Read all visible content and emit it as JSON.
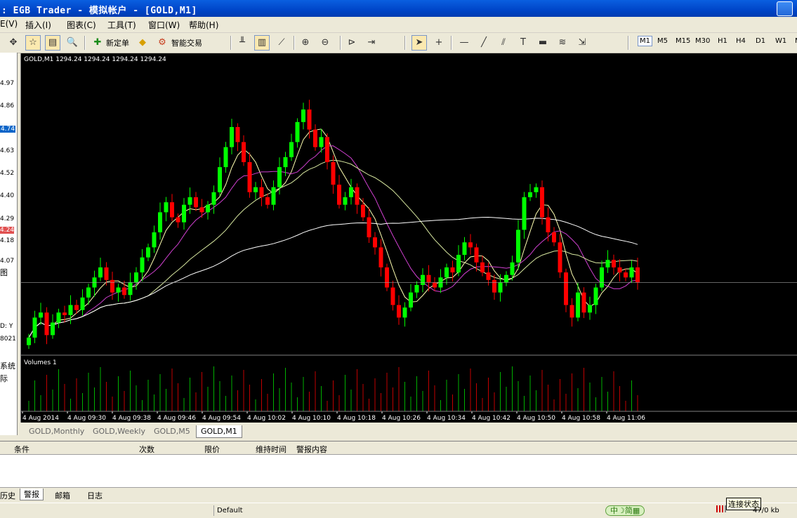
{
  "window": {
    "title": ": EGB Trader - 模拟帐户 - [GOLD,M1]"
  },
  "menu": [
    "E(V)",
    "插入(I)",
    "图表(C)",
    "工具(T)",
    "窗口(W)",
    "帮助(H)"
  ],
  "toolbar": {
    "new_order": "新定单",
    "expert": "智能交易",
    "timeframes": [
      "M1",
      "M5",
      "M15",
      "M30",
      "H1",
      "H4",
      "D1",
      "W1",
      "MN"
    ],
    "active_timeframe": "M1"
  },
  "left_panel": {
    "prices": [
      "4.97",
      "4.86",
      "4.74",
      "4.63",
      "4.52",
      "4.40",
      "4.29",
      "4.24",
      "4.18",
      "4.07"
    ],
    "label_chart": "图",
    "label_text1": "D: Y",
    "label_text2": "8021",
    "label_sys": "系统",
    "label_sys2": "际"
  },
  "chart": {
    "symbol_info": "GOLD,M1  1294.24 1294.24 1294.24 1294.24",
    "volume_label": "Volumes 1",
    "current_price_line": 1294.24,
    "bg": "#000000",
    "bull_color": "#00ff00",
    "bear_color": "#ff0000",
    "time_labels": [
      "4 Aug 2014",
      "4 Aug 09:30",
      "4 Aug 09:38",
      "4 Aug 09:46",
      "4 Aug 09:54",
      "4 Aug 10:02",
      "4 Aug 10:10",
      "4 Aug 10:18",
      "4 Aug 10:26",
      "4 Aug 10:34",
      "4 Aug 10:42",
      "4 Aug 10:50",
      "4 Aug 10:58",
      "4 Aug 11:06"
    ]
  },
  "chart_data": {
    "type": "candlestick",
    "price_range": [
      1293.95,
      1295.07
    ],
    "closes": [
      1294.02,
      1294.1,
      1294.12,
      1294.03,
      1294.08,
      1294.12,
      1294.11,
      1294.15,
      1294.13,
      1294.18,
      1294.22,
      1294.26,
      1294.3,
      1294.25,
      1294.2,
      1294.22,
      1294.19,
      1294.24,
      1294.28,
      1294.34,
      1294.38,
      1294.44,
      1294.52,
      1294.56,
      1294.5,
      1294.48,
      1294.55,
      1294.58,
      1294.54,
      1294.52,
      1294.55,
      1294.6,
      1294.7,
      1294.78,
      1294.86,
      1294.8,
      1294.72,
      1294.6,
      1294.62,
      1294.58,
      1294.55,
      1294.62,
      1294.7,
      1294.74,
      1294.8,
      1294.88,
      1294.93,
      1294.85,
      1294.78,
      1294.82,
      1294.72,
      1294.63,
      1294.55,
      1294.58,
      1294.62,
      1294.55,
      1294.5,
      1294.42,
      1294.38,
      1294.3,
      1294.22,
      1294.15,
      1294.1,
      1294.14,
      1294.2,
      1294.23,
      1294.27,
      1294.24,
      1294.22,
      1294.26,
      1294.3,
      1294.28,
      1294.35,
      1294.4,
      1294.38,
      1294.32,
      1294.28,
      1294.25,
      1294.2,
      1294.24,
      1294.27,
      1294.32,
      1294.45,
      1294.58,
      1294.6,
      1294.62,
      1294.5,
      1294.44,
      1294.4,
      1294.28,
      1294.15,
      1294.1,
      1294.2,
      1294.12,
      1294.15,
      1294.22,
      1294.3,
      1294.33,
      1294.3,
      1294.28,
      1294.26,
      1294.3,
      1294.24
    ]
  },
  "tabs": [
    "GOLD,Monthly",
    "GOLD,Weekly",
    "GOLD,M5",
    "GOLD,M1"
  ],
  "terminal": {
    "columns": [
      "条件",
      "次数",
      "限价",
      "维持时间",
      "警报内容"
    ]
  },
  "terminal_tabs": [
    "历史",
    "警报",
    "邮箱",
    "日志"
  ],
  "status": {
    "profile": "Default",
    "traffic": "47/0 kb",
    "tooltip": "连接状态"
  }
}
